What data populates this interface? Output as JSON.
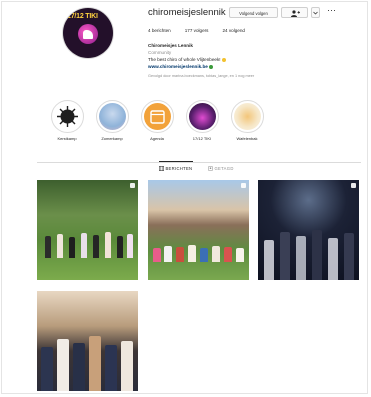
{
  "profile": {
    "username": "chiromeisjeslennik",
    "follow_button": "Volgend volgen",
    "more_icon": "more-icon"
  },
  "stats": {
    "posts": "4 berichten",
    "followers": "177 volgers",
    "following": "24 volgend"
  },
  "bio": {
    "name": "Chiromeisjes Lennik",
    "category": "Community",
    "text": "The best chiro of whole Vlijtenbeek!",
    "link": "www.chiromeisjeslennik.be"
  },
  "followed_by": "Gevolgd door marina.boeckmans, tobias_lange, en 1 nog meer",
  "highlights": [
    {
      "label": "Kerstkamp",
      "color": "#1f1f1f"
    },
    {
      "label": "Zomerkamp",
      "color": "#8fb3d9"
    },
    {
      "label": "Agenda",
      "color": "#f2a23a"
    },
    {
      "label": "17/12 TIKI",
      "color": "#5a1f6e"
    },
    {
      "label": "Wafelenbak",
      "color": "#f6e7c8"
    }
  ],
  "tabs": {
    "posts": "BERICHTEN",
    "tagged": "GETAGD"
  },
  "colors": {
    "link": "#00376b",
    "divider": "#dbdbdb"
  }
}
